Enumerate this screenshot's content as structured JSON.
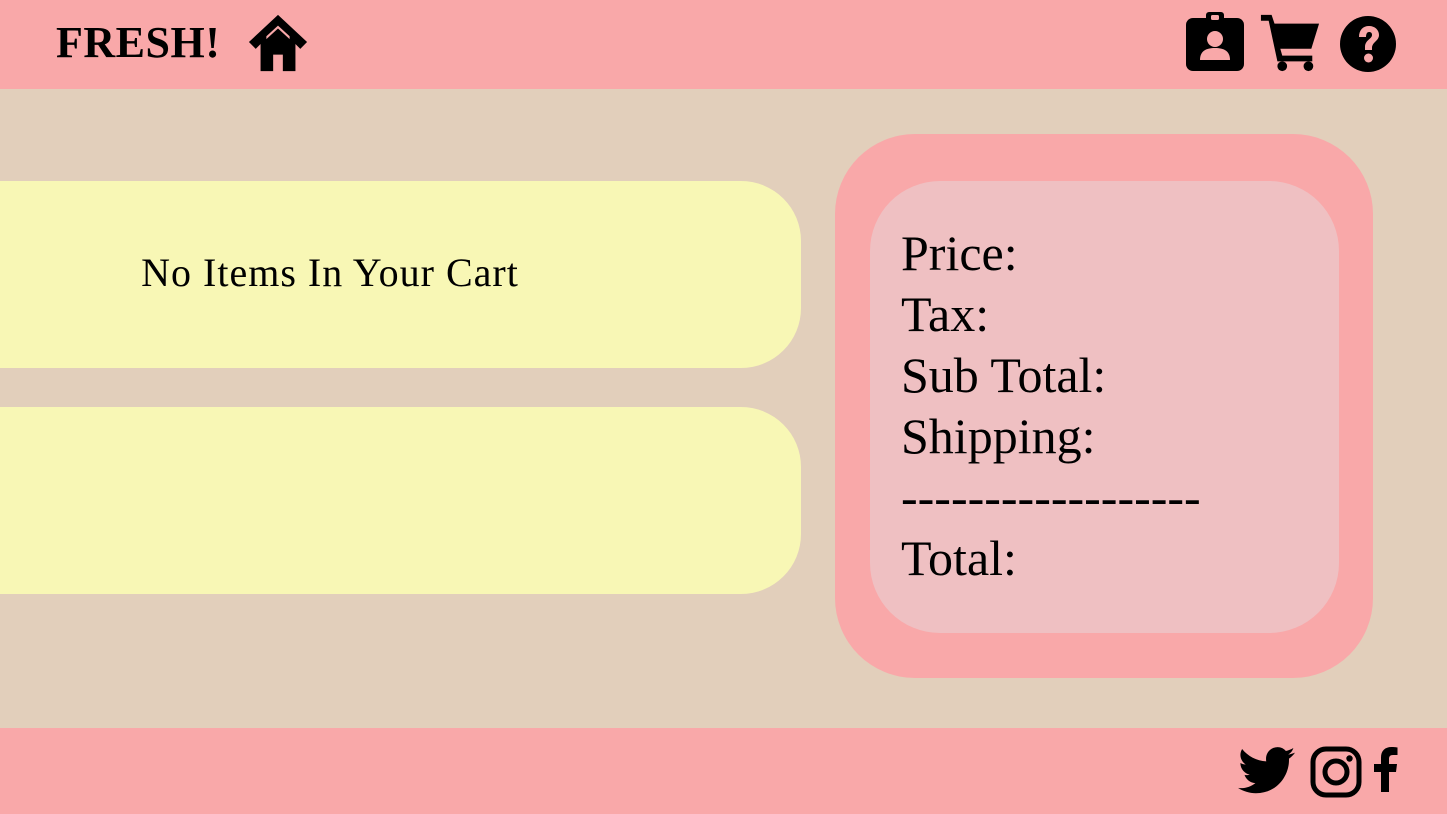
{
  "header": {
    "brand": "FRESH!",
    "icons": [
      "home-icon",
      "profile-badge-icon",
      "cart-icon",
      "help-icon"
    ]
  },
  "cart": {
    "empty_message": "No Items In Your Cart"
  },
  "summary": {
    "price_label": "Price:",
    "tax_label": "Tax:",
    "subtotal_label": "Sub Total:",
    "shipping_label": "Shipping:",
    "divider": "------------------",
    "total_label": "Total:"
  },
  "footer": {
    "icons": [
      "twitter-icon",
      "instagram-icon",
      "facebook-icon"
    ]
  },
  "colors": {
    "header_bg": "#f9a8a9",
    "page_bg": "#e2cfbb",
    "panel_bg": "#f8f7b5",
    "summary_outer": "#f9a8a9",
    "summary_inner": "#efc0c2"
  }
}
